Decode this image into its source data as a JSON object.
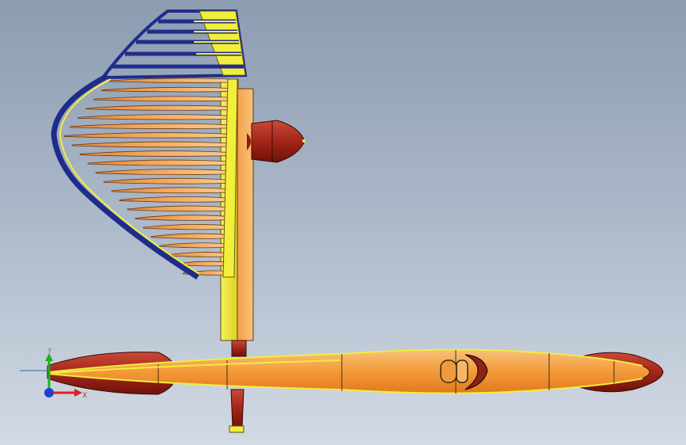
{
  "view": {
    "background_top": "#8d9cb1",
    "background_bottom": "#d2dae4"
  },
  "colors": {
    "frame_blue": "#1f2d8a",
    "spar_yellow": "#f2ee3c",
    "rib_orange": "#f59a4c",
    "fuselage_orange": "#f7a23e",
    "motor_red": "#a3251a",
    "outline": "#3a2a10"
  },
  "triad": {
    "x_label": "X",
    "y_label": "Y",
    "x_color": "#e02020",
    "y_color": "#20b020",
    "z_color": "#2040d0"
  },
  "model": {
    "parts": [
      "wing-frame",
      "wing-ribs",
      "vertical-spar",
      "propeller-nacelle",
      "fuselage",
      "tail-cone",
      "nose-pod",
      "cockpit",
      "tail-fin"
    ]
  }
}
